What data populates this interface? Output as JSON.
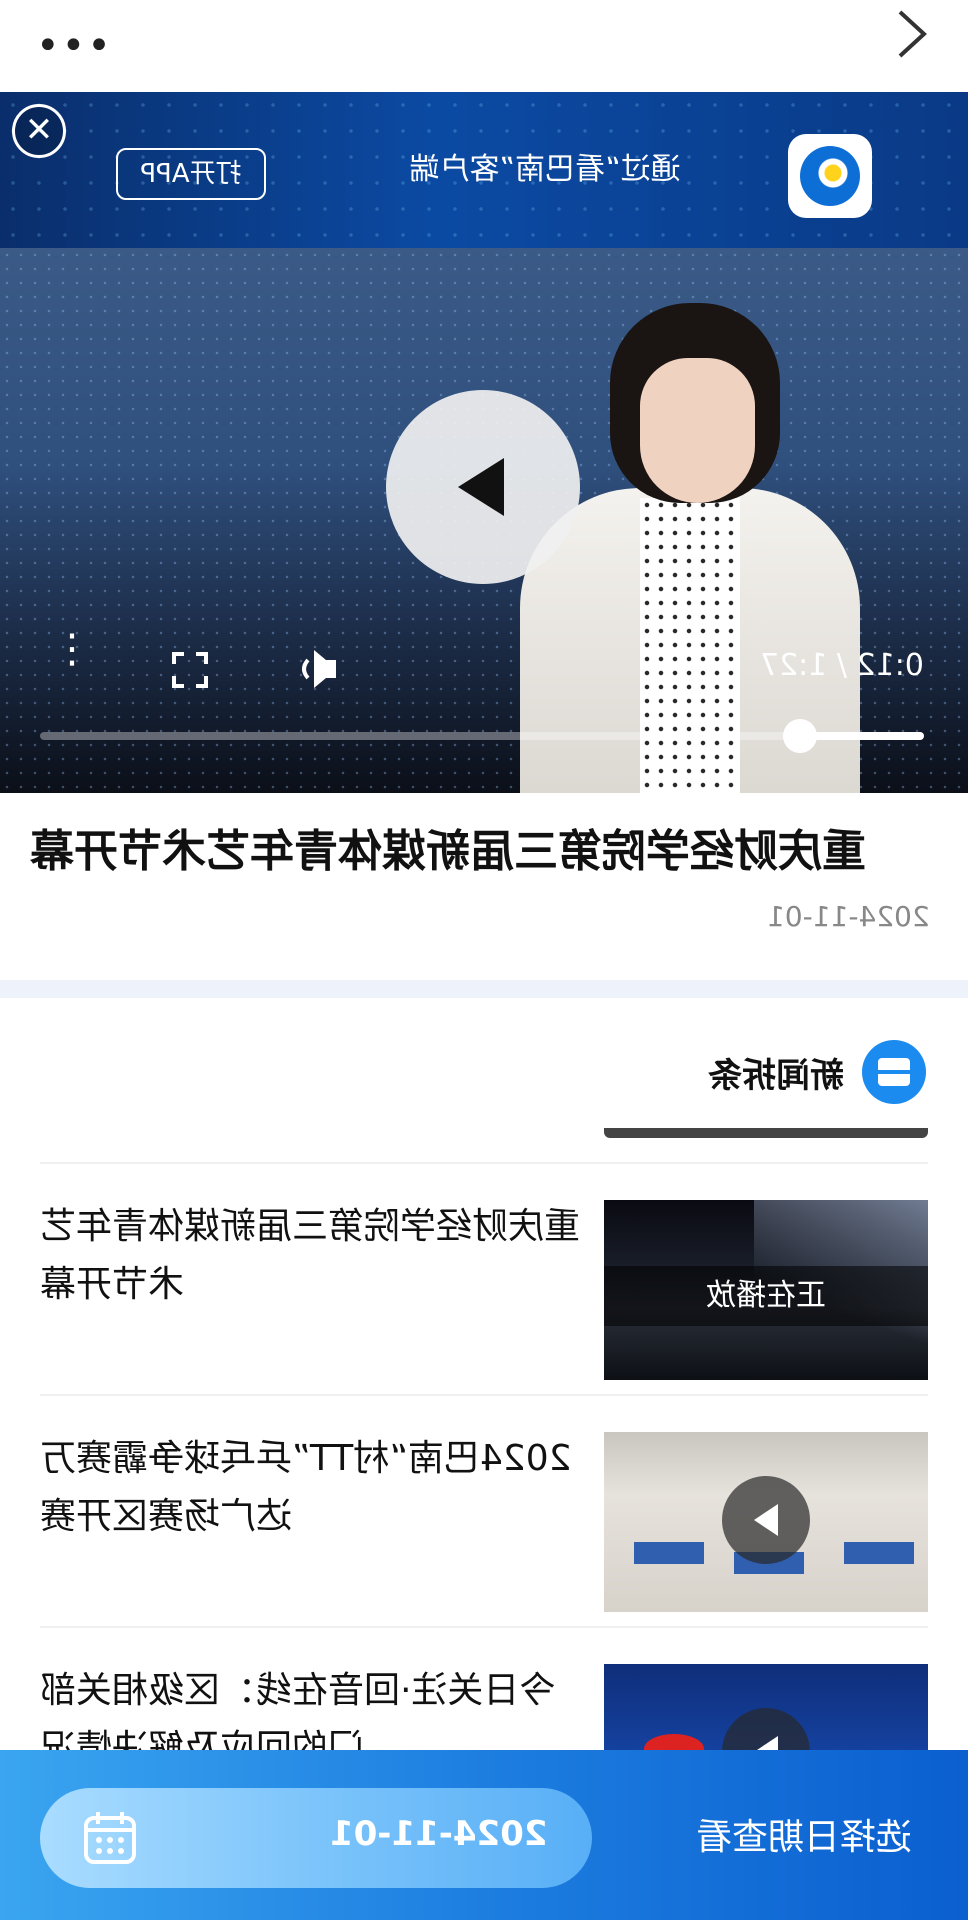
{
  "header": {
    "more_icon": "more-horizontal-icon",
    "chevron_icon": "chevron-right-icon"
  },
  "banner": {
    "close_icon": "close-icon",
    "open_app_label": "打开APP",
    "promo_text": "通过“看巴南”客户端",
    "logo_icon": "app-logo-icon"
  },
  "video": {
    "time_display": "0:12 / 1:27",
    "progress_fraction": 0.14,
    "controls": [
      "more-vertical-icon",
      "fullscreen-icon",
      "volume-icon"
    ]
  },
  "article": {
    "title": "重庆财经学院第三届新媒体青年艺术节开幕",
    "date": "2024-11-01"
  },
  "section": {
    "title": "新闻拆条",
    "icon": "news-icon"
  },
  "list": [
    {
      "text": "重庆财经学院第三届新媒体青年艺术节开幕",
      "badge": "正在播放"
    },
    {
      "text": "2024巴南“村TT”乒乓球争霸赛万达广场赛区开赛"
    },
    {
      "text": "今日关注·回音在线：区级相关部门的回应及解决情况"
    }
  ],
  "footer": {
    "selected_date": "2024-11-01",
    "pick_date_label": "选择日期查看",
    "calendar_icon": "calendar-icon"
  },
  "colors": {
    "accent": "#1b8bf0",
    "footer_start": "#3aa5f0",
    "footer_end": "#0b5fcf"
  }
}
